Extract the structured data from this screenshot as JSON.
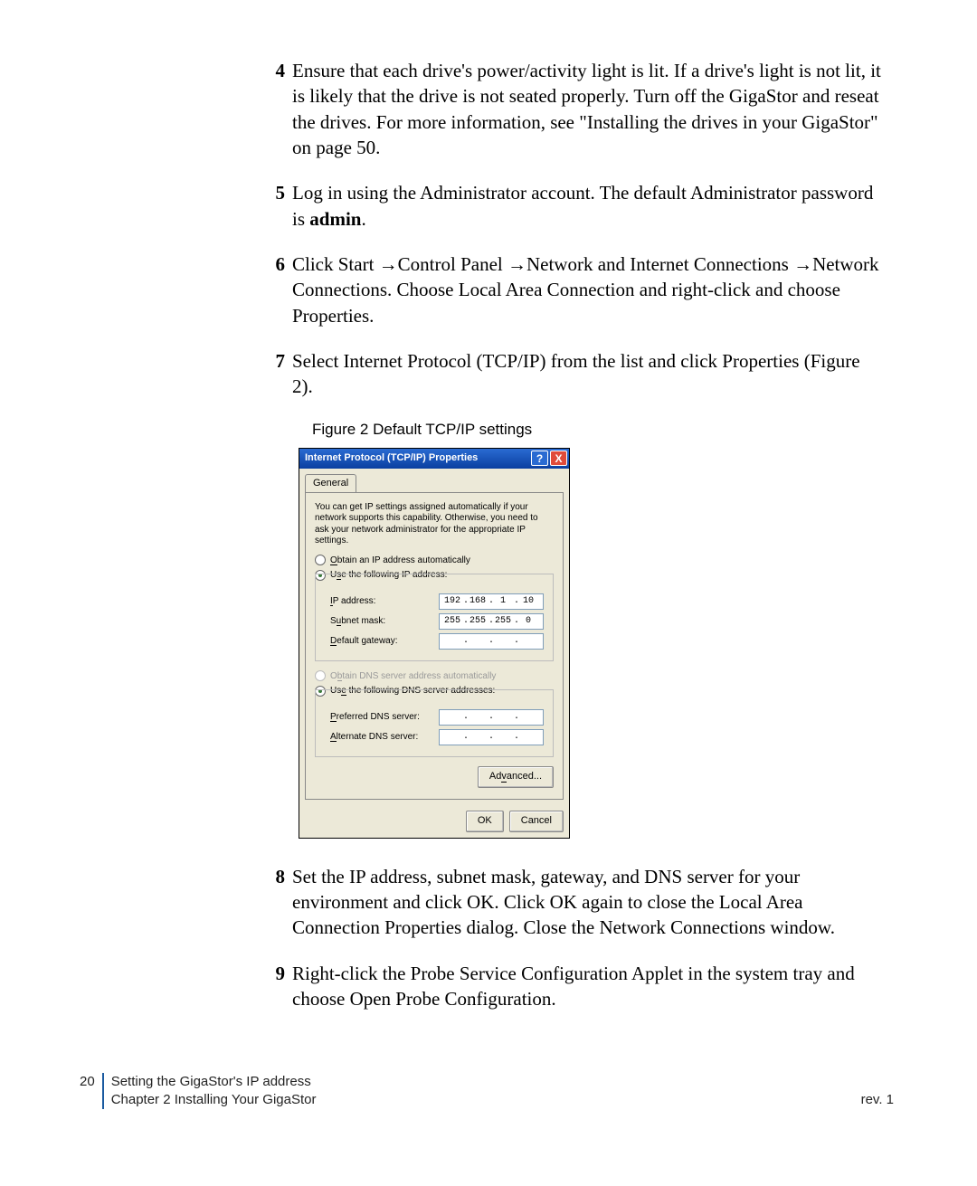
{
  "steps": [
    {
      "n": "4",
      "text": "Ensure that each drive's power/activity light is lit. If a drive's light is not lit, it is likely that the drive is not seated properly. Turn off the GigaStor and reseat the drives. For more information, see \"Installing the drives in your GigaStor\" on page 50."
    },
    {
      "n": "5",
      "text_pre": "Log in using the Administrator account. The default Administrator password is ",
      "text_bold": "admin",
      "text_post": "."
    },
    {
      "n": "6",
      "text": "Click Start →Control Panel →Network and Internet Connections →Network Connections. Choose Local Area Connection and right-click and choose Properties."
    },
    {
      "n": "7",
      "text": "Select Internet Protocol (TCP/IP) from the list and click Properties (Figure 2)."
    }
  ],
  "figure_caption": "Figure 2  Default TCP/IP settings",
  "dialog": {
    "title": "Internet Protocol (TCP/IP) Properties",
    "help_icon": "?",
    "close_icon": "X",
    "tab": "General",
    "description": "You can get IP settings assigned automatically if your network supports this capability. Otherwise, you need to ask your network administrator for the appropriate IP settings.",
    "radio_ip_auto": "Obtain an IP address automatically",
    "radio_ip_manual": "Use the following IP address:",
    "ip_label": "IP address:",
    "ip_value": [
      "192",
      "168",
      "1",
      "10"
    ],
    "subnet_label": "Subnet mask:",
    "subnet_value": [
      "255",
      "255",
      "255",
      "0"
    ],
    "gateway_label": "Default gateway:",
    "gateway_value": [
      "",
      "",
      "",
      ""
    ],
    "radio_dns_auto": "Obtain DNS server address automatically",
    "radio_dns_manual": "Use the following DNS server addresses:",
    "pref_dns_label": "Preferred DNS server:",
    "pref_dns_value": [
      "",
      "",
      "",
      ""
    ],
    "alt_dns_label": "Alternate DNS server:",
    "alt_dns_value": [
      "",
      "",
      "",
      ""
    ],
    "advanced": "Advanced...",
    "ok": "OK",
    "cancel": "Cancel"
  },
  "steps_after": [
    {
      "n": "8",
      "text": "Set the IP address, subnet mask, gateway, and DNS server for your environment and click OK. Click OK again to close the Local Area Connection Properties dialog. Close the Network Connections window."
    },
    {
      "n": "9",
      "text": "Right-click the Probe Service Configuration Applet in the system tray and choose Open Probe Configuration."
    }
  ],
  "footer": {
    "page_number": "20",
    "section": "Setting the GigaStor's IP address",
    "chapter": "Chapter 2 Installing Your GigaStor",
    "rev": "rev. 1"
  }
}
